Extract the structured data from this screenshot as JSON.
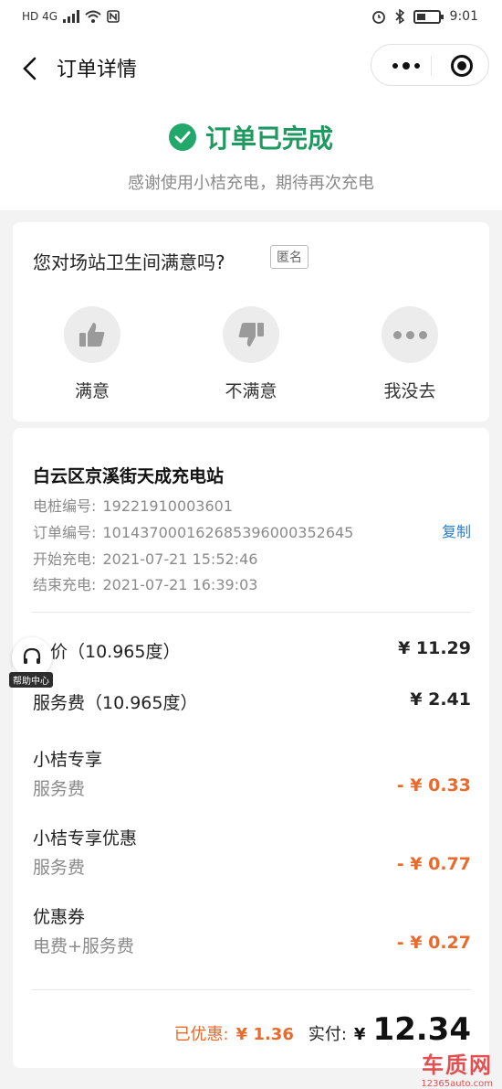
{
  "status_bar": {
    "left": "HD 4G",
    "time": "9:01"
  },
  "header": {
    "title": "订单详情"
  },
  "completion": {
    "title": "订单已完成",
    "subtitle": "感谢使用小桔充电，期待再次充电",
    "accent": "#1e9a60"
  },
  "survey": {
    "question": "您对场站卫生间满意吗?",
    "anonymous": "匿名",
    "options": [
      {
        "label": "满意",
        "icon": "thumbs-up-icon"
      },
      {
        "label": "不满意",
        "icon": "thumbs-down-icon"
      },
      {
        "label": "我没去",
        "icon": "more-dots-icon"
      }
    ]
  },
  "order": {
    "station": "白云区京溪街天成充电站",
    "pile_no": {
      "label": "电桩编号:",
      "value": "19221910003601"
    },
    "order_no": {
      "label": "订单编号:",
      "value": "10143700016268539600035264​5"
    },
    "start": {
      "label": "开始充电:",
      "value": "2021-07-21 15:52:46"
    },
    "end": {
      "label": "结束充电:",
      "value": "2021-07-21 16:39:03"
    },
    "copy": "复制"
  },
  "fees": {
    "electricity": {
      "label": "电价（10.965度）",
      "value": "¥ 11.29"
    },
    "service": {
      "label": "服务费（10.965度）",
      "value": "¥ 2.41"
    },
    "discounts": [
      {
        "title": "小桔专享",
        "sub": "服务费",
        "value": "- ¥ 0.33"
      },
      {
        "title": "小桔专享优惠",
        "sub": "服务费",
        "value": "- ¥ 0.77"
      },
      {
        "title": "优惠券",
        "sub": "电费+服务费",
        "value": "- ¥ 0.27"
      }
    ]
  },
  "total": {
    "saved_label": "已优惠:",
    "saved_value": "¥ 1.36",
    "paid_label": "实付:",
    "currency": "¥",
    "paid_value": "12.34"
  },
  "help": {
    "label": "帮助中心"
  },
  "watermark": {
    "main": "车质网",
    "sub": "12365auto.com"
  },
  "colors": {
    "discount": "#e86a2c",
    "link": "#2a7fd4",
    "success": "#22a86a"
  }
}
